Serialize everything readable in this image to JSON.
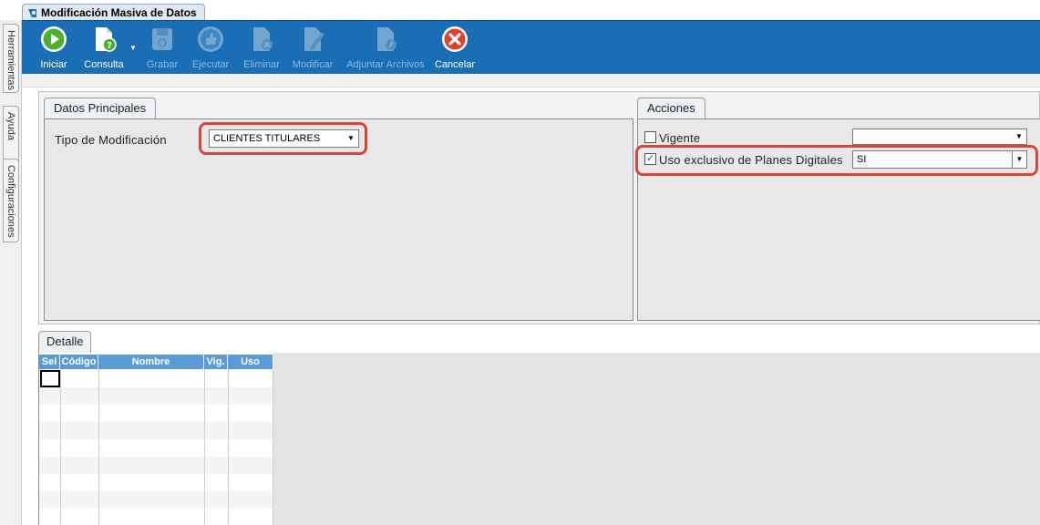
{
  "window": {
    "title": "Modificación Masiva de Datos"
  },
  "side_tabs": [
    "Herramientas",
    "Ayuda",
    "Configuraciones"
  ],
  "toolbar": {
    "buttons": [
      {
        "label": "Iniciar",
        "icon": "play-icon",
        "enabled": true
      },
      {
        "label": "Consulta",
        "icon": "document-help-icon",
        "enabled": true
      },
      {
        "label": "Grabar",
        "icon": "save-disk-icon",
        "enabled": false
      },
      {
        "label": "Ejecutar",
        "icon": "thumbs-up-icon",
        "enabled": false
      },
      {
        "label": "Eliminar",
        "icon": "document-delete-icon",
        "enabled": false
      },
      {
        "label": "Modificar",
        "icon": "document-edit-icon",
        "enabled": false
      },
      {
        "label": "Adjuntar Archivos",
        "icon": "attach-document-icon",
        "enabled": false
      },
      {
        "label": "Cancelar",
        "icon": "cancel-x-icon",
        "enabled": true
      }
    ]
  },
  "datos_principales": {
    "tab_label": "Datos Principales",
    "tipo_label": "Tipo de Modificación",
    "tipo_value": "CLIENTES TITULARES"
  },
  "acciones": {
    "tab_label": "Acciones",
    "vigente_label": "Vigente",
    "vigente_checked": false,
    "vigente_value": "",
    "uso_label": "Uso exclusivo de Planes Digitales",
    "uso_checked": true,
    "uso_value": "SI"
  },
  "detalle": {
    "tab_label": "Detalle",
    "columns": [
      "Sel",
      "Código",
      "Nombre",
      "Vig.",
      "Uso"
    ]
  },
  "colors": {
    "toolbar_bg": "#1a6eb5",
    "header_bg": "#5b9bd5",
    "highlight": "#d9453a"
  }
}
